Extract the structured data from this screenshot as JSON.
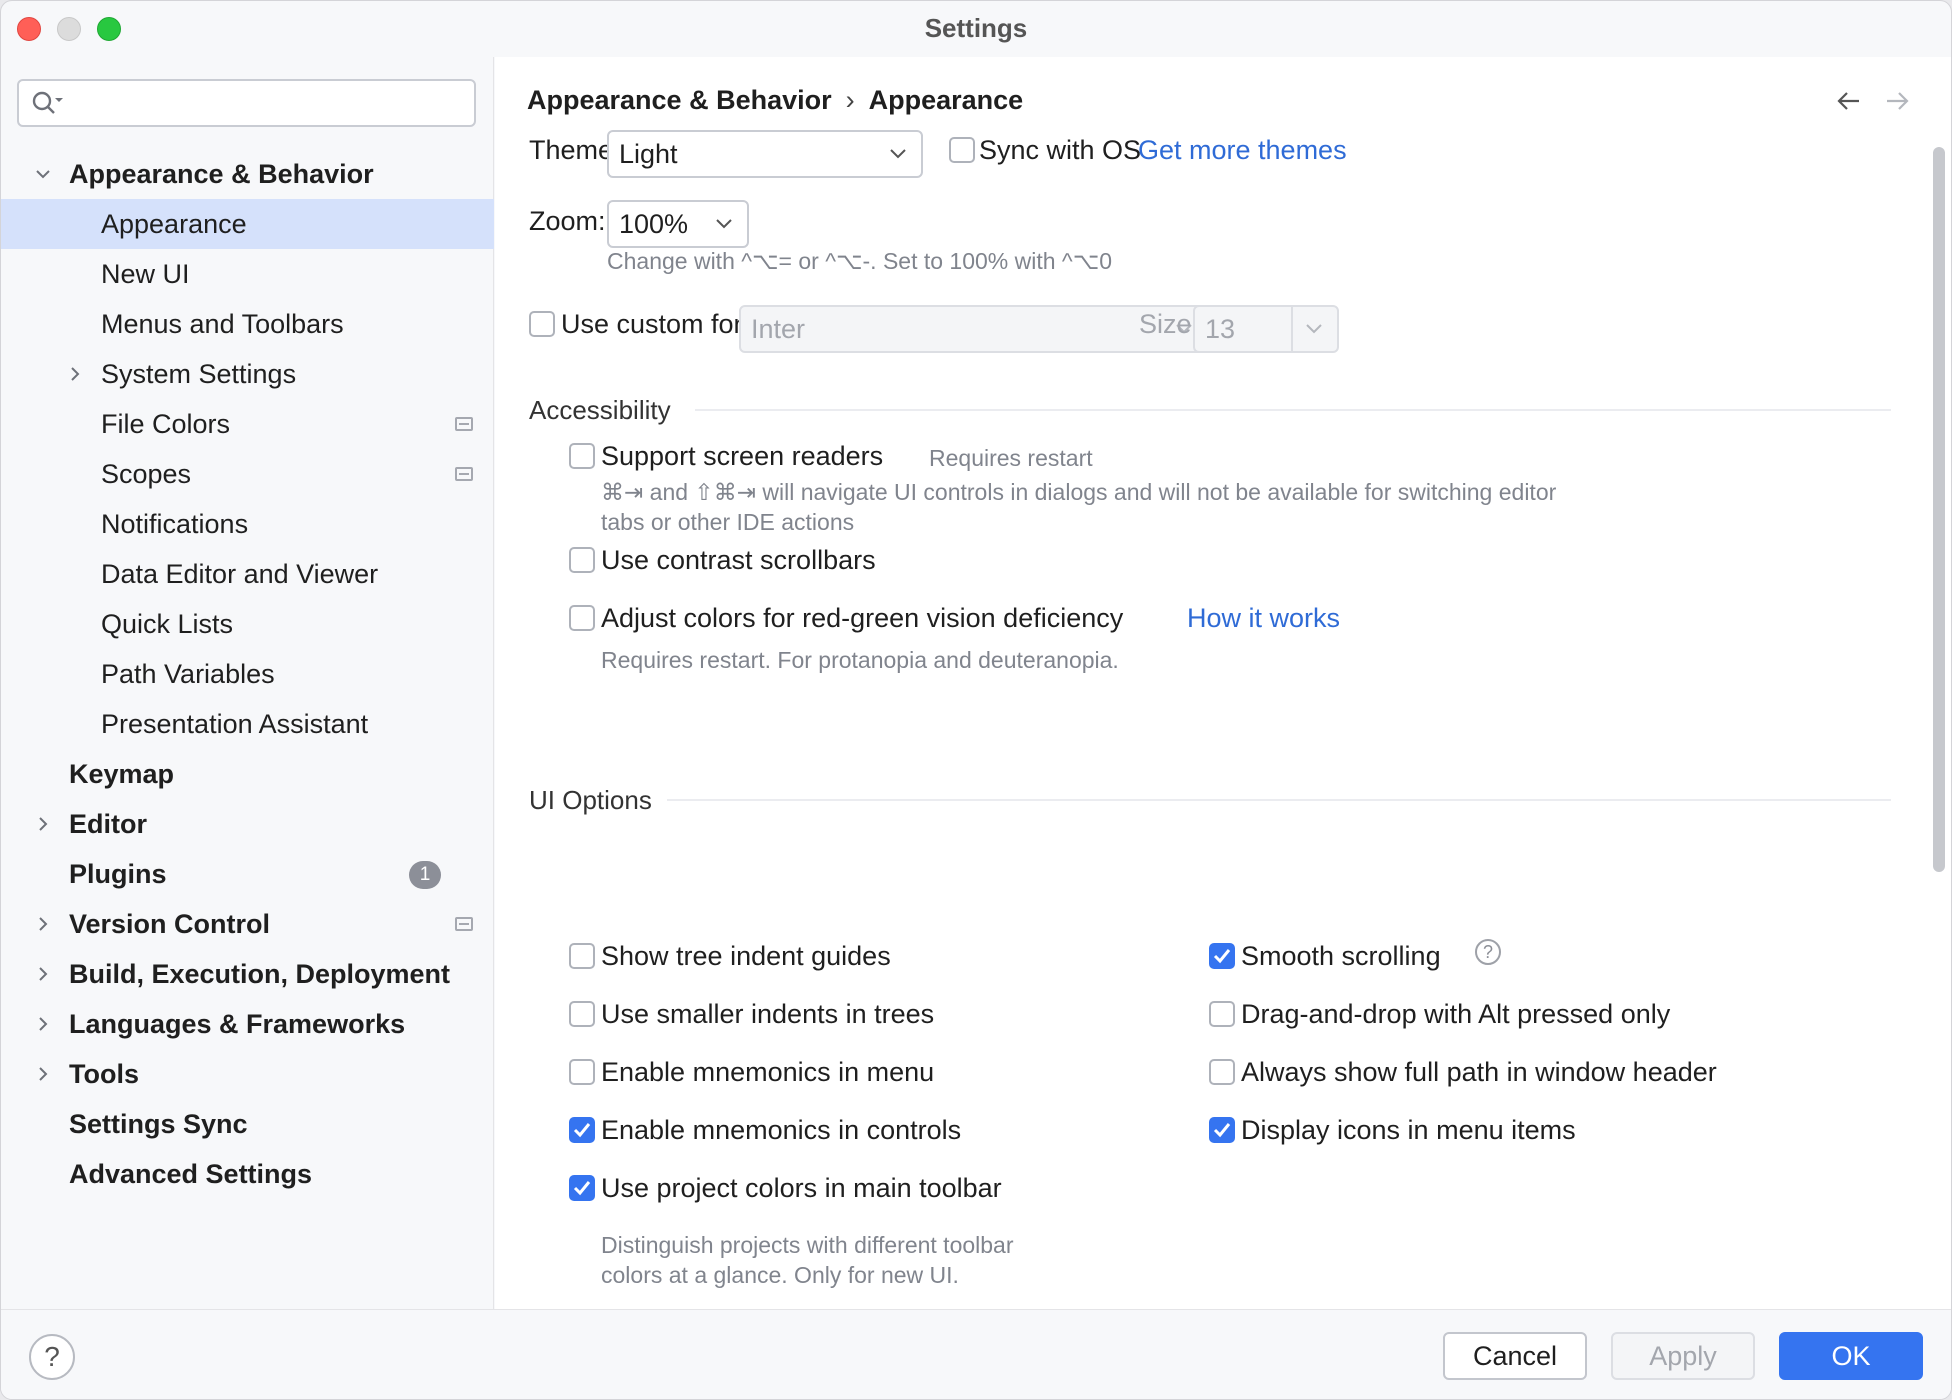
{
  "window": {
    "title": "Settings"
  },
  "sidebar": {
    "search_placeholder": "",
    "items": [
      {
        "label": "Appearance & Behavior",
        "level": 0,
        "expandable": true,
        "expanded": true
      },
      {
        "label": "Appearance",
        "level": 1,
        "selected": true
      },
      {
        "label": "New UI",
        "level": 1
      },
      {
        "label": "Menus and Toolbars",
        "level": 1
      },
      {
        "label": "System Settings",
        "level": 1,
        "expandable": true
      },
      {
        "label": "File Colors",
        "level": 1,
        "icon": "project-level-icon"
      },
      {
        "label": "Scopes",
        "level": 1,
        "icon": "project-level-icon"
      },
      {
        "label": "Notifications",
        "level": 1
      },
      {
        "label": "Data Editor and Viewer",
        "level": 1
      },
      {
        "label": "Quick Lists",
        "level": 1
      },
      {
        "label": "Path Variables",
        "level": 1
      },
      {
        "label": "Presentation Assistant",
        "level": 1
      },
      {
        "label": "Keymap",
        "level": 0
      },
      {
        "label": "Editor",
        "level": 0,
        "expandable": true
      },
      {
        "label": "Plugins",
        "level": 0,
        "badge": "1"
      },
      {
        "label": "Version Control",
        "level": 0,
        "expandable": true,
        "icon": "project-level-icon"
      },
      {
        "label": "Build, Execution, Deployment",
        "level": 0,
        "expandable": true
      },
      {
        "label": "Languages & Frameworks",
        "level": 0,
        "expandable": true
      },
      {
        "label": "Tools",
        "level": 0,
        "expandable": true
      },
      {
        "label": "Settings Sync",
        "level": 0
      },
      {
        "label": "Advanced Settings",
        "level": 0
      }
    ]
  },
  "breadcrumb": {
    "parent": "Appearance & Behavior",
    "separator": "›",
    "current": "Appearance"
  },
  "theme": {
    "label": "Theme:",
    "value": "Light",
    "sync_label": "Sync with OS",
    "sync_checked": false,
    "more_link": "Get more themes"
  },
  "zoom": {
    "label": "Zoom:",
    "value": "100%",
    "hint": "Change with ^⌥= or ^⌥-. Set to 100% with ^⌥0"
  },
  "font": {
    "label": "Use custom font:",
    "checked": false,
    "value": "Inter",
    "size_label": "Size:",
    "size_value": "13"
  },
  "accessibility": {
    "title": "Accessibility",
    "screen_readers": {
      "label": "Support screen readers",
      "checked": false,
      "note": "Requires restart",
      "hint_line1": "⌘⇥ and ⇧⌘⇥ will navigate UI controls in dialogs and will not be available for switching editor",
      "hint_line2": "tabs or other IDE actions"
    },
    "contrast_scrollbars": {
      "label": "Use contrast scrollbars",
      "checked": false
    },
    "color_deficiency": {
      "label": "Adjust colors for red-green vision deficiency",
      "checked": false,
      "link": "How it works",
      "hint": "Requires restart. For protanopia and deuteranopia."
    }
  },
  "ui_options": {
    "title": "UI Options",
    "left": [
      {
        "label": "Show tree indent guides",
        "checked": false
      },
      {
        "label": "Use smaller indents in trees",
        "checked": false
      },
      {
        "label": "Enable mnemonics in menu",
        "checked": false
      },
      {
        "label": "Enable mnemonics in controls",
        "checked": true
      },
      {
        "label": "Use project colors in main toolbar",
        "checked": true
      }
    ],
    "right": [
      {
        "label": "Smooth scrolling",
        "checked": true
      },
      {
        "label": "Drag-and-drop with Alt pressed only",
        "checked": false
      },
      {
        "label": "Always show full path in window header",
        "checked": false
      },
      {
        "label": "Display icons in menu items",
        "checked": true
      }
    ],
    "project_colors_hint_line1": "Distinguish projects with different toolbar",
    "project_colors_hint_line2": "colors at a glance. Only for new UI."
  },
  "footer": {
    "help": "?",
    "cancel": "Cancel",
    "apply": "Apply",
    "ok": "OK"
  },
  "colors": {
    "accent": "#3574f0",
    "selection": "#d5e1fb",
    "link": "#2f6bd6"
  }
}
